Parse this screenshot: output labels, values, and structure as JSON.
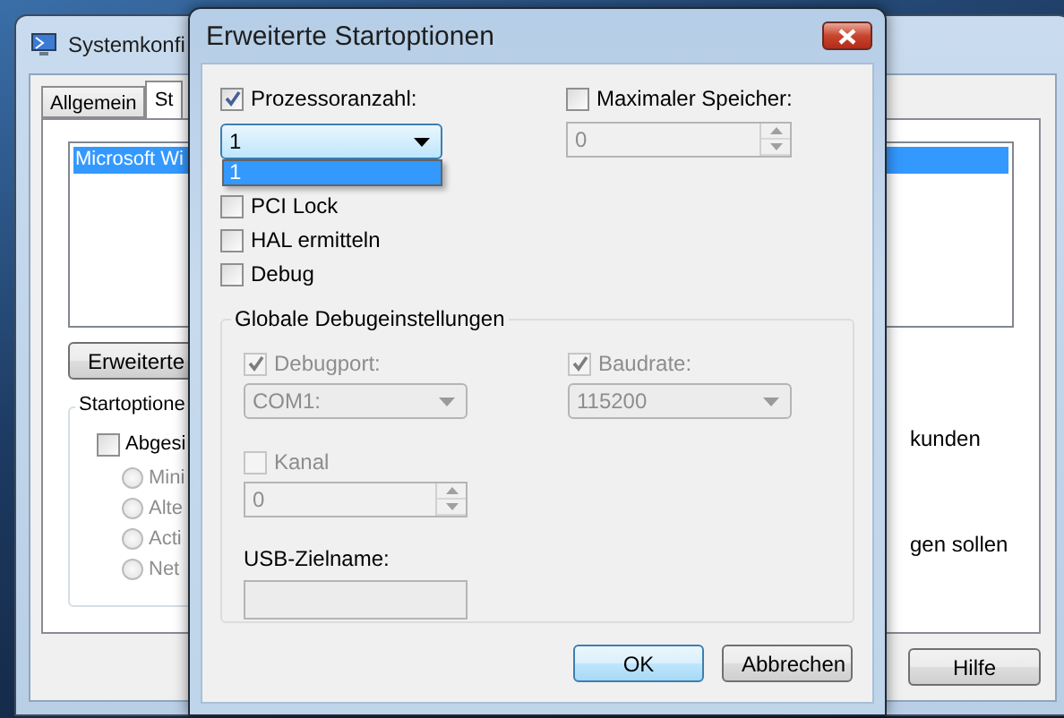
{
  "background_window": {
    "title": "Systemkonfi",
    "tabs": [
      {
        "label": "Allgemein",
        "selected": false
      },
      {
        "label": "St",
        "selected": true
      }
    ],
    "boot_list": [
      {
        "label": "Microsoft Wi",
        "selected": true
      }
    ],
    "advanced_button": "Erweiterte",
    "startup_group": {
      "title": "Startoptione",
      "safe_boot": {
        "label": "Abgesi",
        "checked": false
      },
      "radios": [
        {
          "label": "Mini",
          "selected": false,
          "disabled": true
        },
        {
          "label": "Alte",
          "selected": false,
          "disabled": true
        },
        {
          "label": "Acti",
          "selected": false,
          "disabled": true
        },
        {
          "label": "Net",
          "selected": false,
          "disabled": true
        }
      ]
    },
    "right_texts": [
      "kunden",
      "gen sollen"
    ],
    "buttons": [
      "Hilfe"
    ]
  },
  "dialog": {
    "title": "Erweiterte Startoptionen",
    "processor_count": {
      "label": "Prozessoranzahl:",
      "checked": true,
      "value": "1",
      "dropdown": [
        {
          "label": "1",
          "selected": true
        }
      ]
    },
    "options": [
      {
        "label": "PCI Lock",
        "checked": false
      },
      {
        "label": "HAL ermitteln",
        "checked": false
      },
      {
        "label": "Debug",
        "checked": false
      }
    ],
    "max_memory": {
      "label": "Maximaler Speicher:",
      "checked": false,
      "value": "0"
    },
    "debug_settings": {
      "title": "Globale Debugeinstellungen",
      "debug_port": {
        "label": "Debugport:",
        "checked": true,
        "disabled": true,
        "value": "COM1:"
      },
      "baud_rate": {
        "label": "Baudrate:",
        "checked": true,
        "disabled": true,
        "value": "115200"
      },
      "channel": {
        "label": "Kanal",
        "checked": false,
        "disabled": true,
        "value": "0"
      },
      "usb_target": {
        "label": "USB-Zielname:"
      }
    },
    "buttons": [
      {
        "label": "OK",
        "default": true
      },
      {
        "label": "Abbrechen",
        "default": false
      }
    ]
  }
}
